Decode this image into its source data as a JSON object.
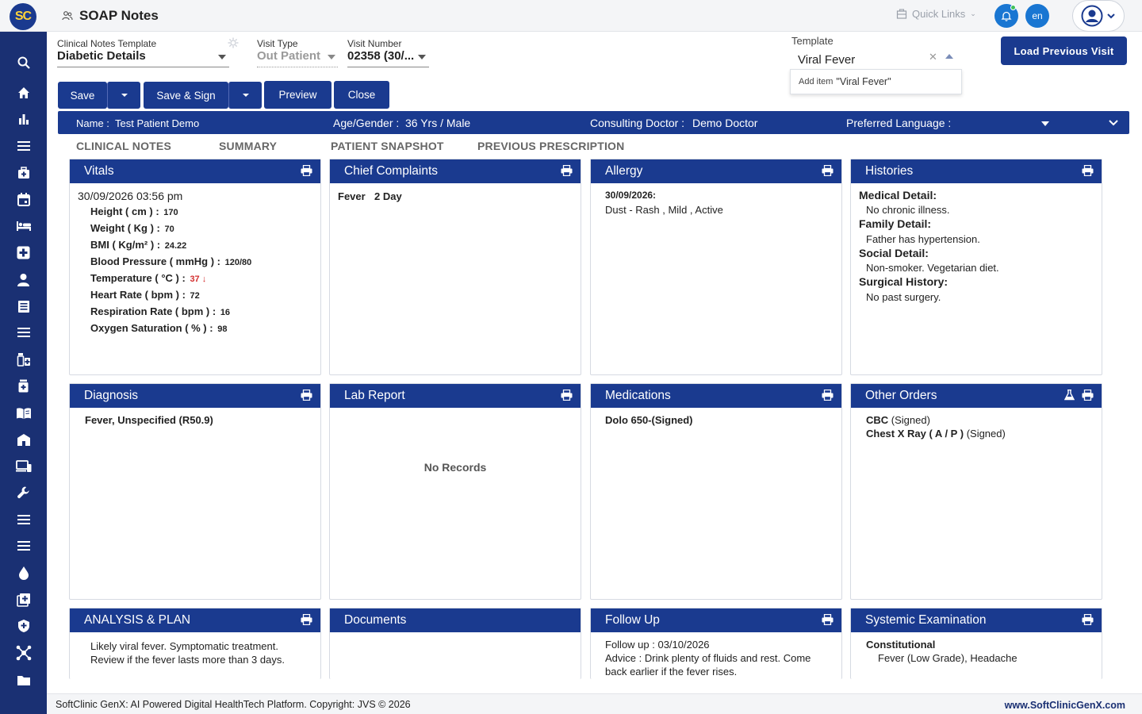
{
  "app": {
    "logo_text": "SC",
    "page_title": "SOAP Notes",
    "quick_links": "Quick Links",
    "language_badge": "en",
    "footer_left": "SoftClinic GenX: AI Powered Digital HealthTech Platform. Copyright: JVS © 2026",
    "footer_right": "www.SoftClinicGenX.com",
    "accent_color": "#1a3a8f",
    "sidebar_color": "#1a3073"
  },
  "sidebar": {
    "icons": [
      "search-icon",
      "home-icon",
      "bar-chart-icon",
      "menu-icon",
      "medical-bag-icon",
      "calendar-icon",
      "bed-icon",
      "hospital-cross-icon",
      "person-icon",
      "document-list-icon",
      "menu-icon",
      "medicines-icon",
      "pharmacy-icon",
      "book-icon",
      "building-icon",
      "devices-icon",
      "wrench-icon",
      "menu-icon",
      "menu-icon",
      "drop-icon",
      "add-box-icon",
      "shield-icon",
      "network-icon",
      "folder-icon"
    ]
  },
  "form": {
    "template_label": "Clinical Notes Template",
    "template_value": "Diabetic Details",
    "visit_type_label": "Visit Type",
    "visit_type_value": "Out Patient",
    "visit_number_label": "Visit Number",
    "visit_number_value": "02358 (30/...",
    "template_search_label": "Template",
    "template_search_value": "Viral Fever",
    "dropdown_prefix": "Add item",
    "dropdown_value": "\"Viral Fever\"",
    "load_previous": "Load Previous Visit"
  },
  "toolbar": {
    "save": "Save",
    "save_sign": "Save & Sign",
    "preview": "Preview",
    "close": "Close"
  },
  "patient": {
    "name_label": "Name :",
    "name": "Test Patient Demo",
    "age_label": "Age/Gender :",
    "age": "36 Yrs / Male",
    "doctor_label": "Consulting Doctor :",
    "doctor": "Demo Doctor",
    "language_label": "Preferred Language :"
  },
  "tabs": [
    "CLINICAL NOTES",
    "SUMMARY",
    "PATIENT SNAPSHOT",
    "PREVIOUS PRESCRIPTION"
  ],
  "cards": {
    "vitals": {
      "title": "Vitals",
      "date": "30/09/2026 03:56 pm",
      "items": [
        {
          "label": "Height ( cm ) :",
          "value": "170"
        },
        {
          "label": "Weight ( Kg ) :",
          "value": "70"
        },
        {
          "label": "BMI ( Kg/m² ) :",
          "value": "24.22"
        },
        {
          "label": "Blood Pressure ( mmHg ) :",
          "value": "120/80"
        },
        {
          "label": "Temperature ( °C ) :",
          "value": "37 ↓"
        },
        {
          "label": "Heart Rate ( bpm ) :",
          "value": "72"
        },
        {
          "label": "Respiration Rate ( bpm ) :",
          "value": "16"
        },
        {
          "label": "Oxygen Saturation ( % ) :",
          "value": "98"
        }
      ]
    },
    "complaints": {
      "title": "Chief Complaints",
      "complaint": "Fever",
      "duration": "2 Day"
    },
    "allergy": {
      "title": "Allergy",
      "date": "30/09/2026:",
      "detail": "Dust - Rash , Mild , Active"
    },
    "histories": {
      "title": "Histories",
      "medical_label": "Medical Detail:",
      "medical": "No chronic illness.",
      "family_label": "Family Detail:",
      "family": "Father has hypertension.",
      "social_label": "Social Detail:",
      "social": "Non-smoker. Vegetarian diet.",
      "surgical_label": "Surgical History:",
      "surgical": "No past surgery."
    },
    "diagnosis": {
      "title": "Diagnosis",
      "text": "Fever, Unspecified (R50.9)"
    },
    "lab": {
      "title": "Lab Report",
      "empty": "No Records"
    },
    "medications": {
      "title": "Medications",
      "text": "Dolo 650-(Signed)"
    },
    "orders": {
      "title": "Other Orders",
      "item1_name": "CBC",
      "item1_status": "(Signed)",
      "item2_name": "Chest X Ray ( A / P )",
      "item2_status": "(Signed)"
    },
    "analysis": {
      "title": "ANALYSIS & PLAN",
      "line1": "Likely viral fever. Symptomatic treatment.",
      "line2": "Review if the fever lasts more than 3 days."
    },
    "documents": {
      "title": "Documents"
    },
    "followup": {
      "title": "Follow Up",
      "date": "Follow up : 03/10/2026",
      "line1": "Advice : Drink plenty of fluids and rest. Come",
      "line2": "back earlier if the fever rises."
    },
    "systemic": {
      "title": "Systemic Examination",
      "heading": "Constitutional",
      "text": "Fever (Low Grade), Headache"
    }
  }
}
